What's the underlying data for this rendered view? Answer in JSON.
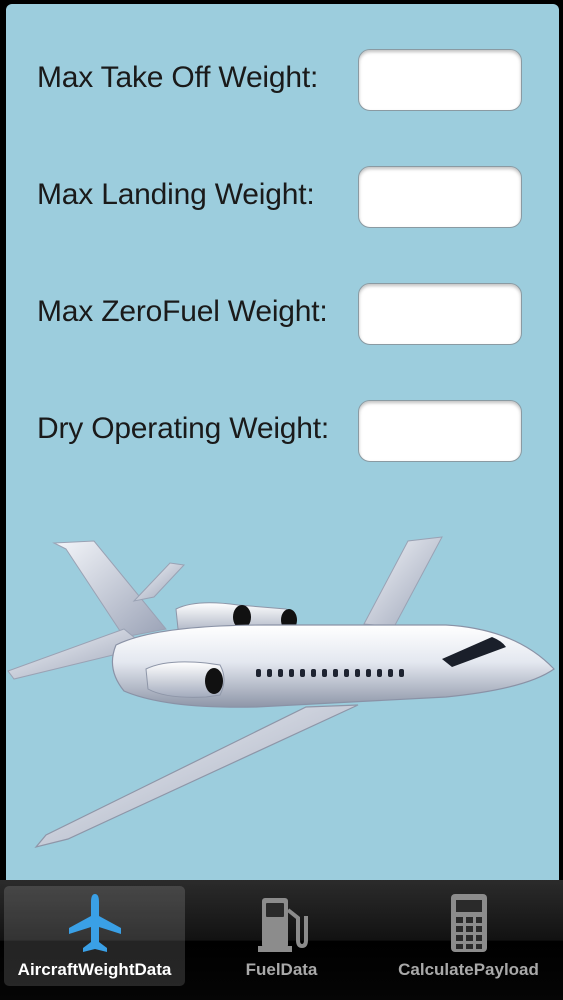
{
  "form": {
    "fields": [
      {
        "label": "Max Take Off Weight:",
        "value": ""
      },
      {
        "label": "Max Landing Weight:",
        "value": ""
      },
      {
        "label": "Max ZeroFuel Weight:",
        "value": ""
      },
      {
        "label": "Dry Operating Weight:",
        "value": ""
      }
    ]
  },
  "tabs": [
    {
      "label": "AircraftWeightData",
      "icon": "airplane-icon",
      "selected": true
    },
    {
      "label": "FuelData",
      "icon": "fuel-pump-icon",
      "selected": false
    },
    {
      "label": "CalculatePayload",
      "icon": "calculator-icon",
      "selected": false
    }
  ],
  "colors": {
    "background": "#9ccddd",
    "tab_selected_icon": "#3aa0e6"
  }
}
